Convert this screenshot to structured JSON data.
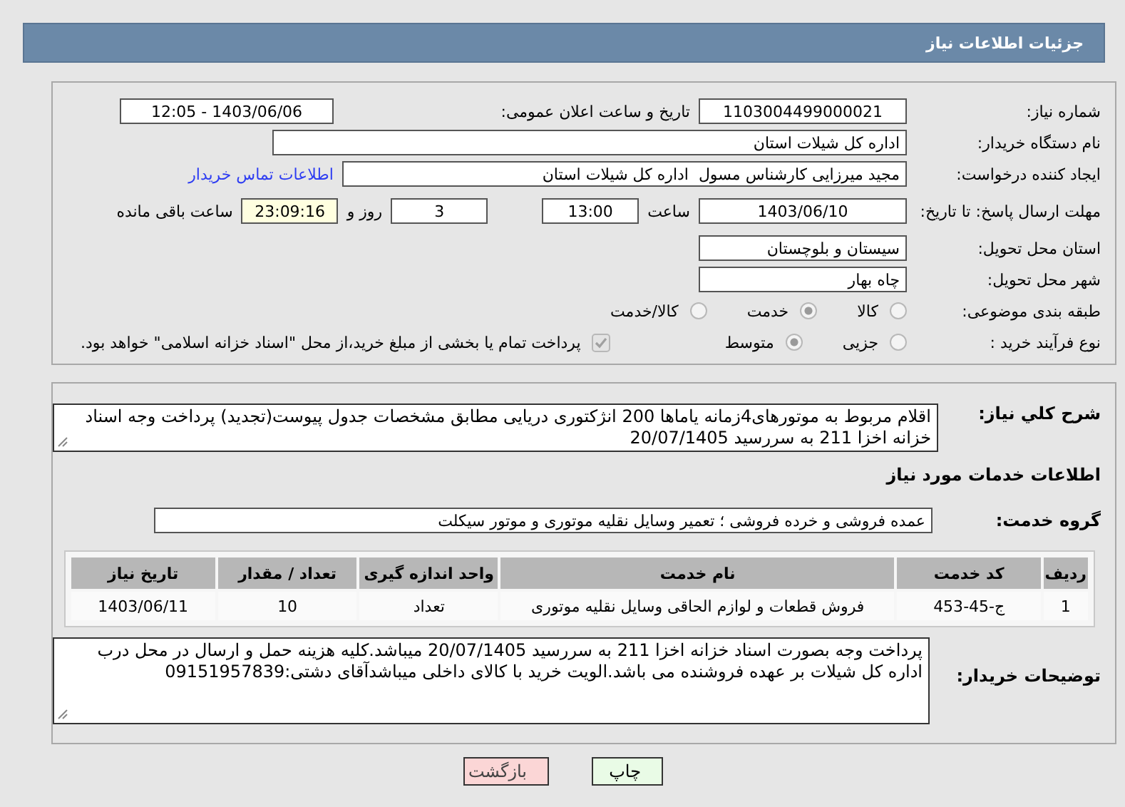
{
  "header": {
    "title": "جزئیات اطلاعات نیاز"
  },
  "need_number": {
    "label": "شماره نیاز:",
    "value": "1103004499000021"
  },
  "announce_date": {
    "label": "تاریخ و ساعت اعلان عمومی:",
    "value": "1403/06/06 - 12:05"
  },
  "buyer_org": {
    "label": "نام دستگاه خریدار:",
    "value": "اداره کل شیلات استان"
  },
  "requester": {
    "label": "ایجاد کننده درخواست:",
    "value": "مجید میرزایی کارشناس مسول  اداره کل شیلات استان",
    "link": "اطلاعات تماس خریدار"
  },
  "deadline": {
    "label": "مهلت ارسال پاسخ: تا تاریخ:",
    "date": "1403/06/10",
    "time_label": "ساعت",
    "time": "13:00",
    "days": "3",
    "days_label": "روز و",
    "remaining": "23:09:16",
    "remaining_label": "ساعت باقی مانده"
  },
  "province": {
    "label": "استان محل تحویل:",
    "value": "سیستان و بلوچستان"
  },
  "city": {
    "label": "شهر محل تحویل:",
    "value": "چاه بهار"
  },
  "category": {
    "label": "طبقه بندی موضوعی:",
    "options": [
      {
        "label": "کالا",
        "selected": false
      },
      {
        "label": "خدمت",
        "selected": true
      },
      {
        "label": "کالا/خدمت",
        "selected": false
      }
    ]
  },
  "purchase_type": {
    "label": "نوع فرآیند خرید :",
    "options": [
      {
        "label": "جزیی",
        "selected": false
      },
      {
        "label": "متوسط",
        "selected": true
      }
    ],
    "treasury": {
      "checked": true,
      "text": "پرداخت تمام یا بخشی از مبلغ خرید،از محل \"اسناد خزانه اسلامی\" خواهد بود."
    }
  },
  "description": {
    "label": "شرح کلي نياز:",
    "value": "اقلام مربوط به موتورهای4زمانه یاماها 200 انژکتوری دریایی مطابق مشخصات جدول پیوست(تجدید) پرداخت وجه اسناد خزانه اخزا 211 به سررسید 20/07/1405"
  },
  "services_heading": "اطلاعات خدمات مورد نیاز",
  "service_group": {
    "label": "گروه خدمت:",
    "value": "عمده فروشی و خرده فروشی ؛ تعمیر وسایل نقلیه موتوری و موتور سیکلت"
  },
  "table": {
    "columns": [
      "ردیف",
      "کد خدمت",
      "نام خدمت",
      "واحد اندازه گیری",
      "تعداد / مقدار",
      "تاریخ نیاز"
    ],
    "rows": [
      [
        "1",
        "ج-45-453",
        "فروش قطعات و لوازم الحاقی وسایل نقلیه موتوری",
        "تعداد",
        "10",
        "1403/06/11"
      ]
    ]
  },
  "buyer_notes": {
    "label": "توضیحات خریدار:",
    "value": "پرداخت وجه بصورت اسناد خزانه اخزا 211 به سررسید 20/07/1405 میباشد.کلیه هزینه حمل و ارسال در محل درب اداره کل شیلات بر عهده فروشنده می باشد.الویت خرید با کالای داخلی میباشدآقای دشتی:09151957839"
  },
  "buttons": [
    {
      "label": "چاپ",
      "kind": "print"
    },
    {
      "label": "بازگشت",
      "kind": "back"
    }
  ]
}
